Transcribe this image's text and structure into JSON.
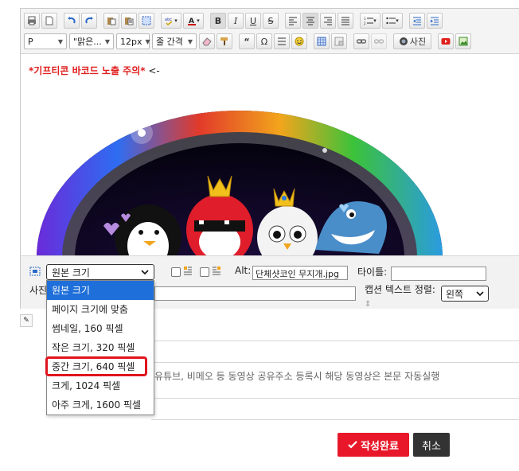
{
  "toolbar": {
    "paragraph_format": "P",
    "font_family": "\"맑은...",
    "font_size": "12px",
    "line_spacing": "줄 간격",
    "quote_glyph": "“",
    "omega_glyph": "Ω",
    "photo_label": "사진"
  },
  "content": {
    "notice_text": "*기프티콘 바코드 노출 주의*",
    "notice_arrow": " <-"
  },
  "image_props": {
    "alt_label": "Alt:",
    "alt_value": "단체샷코인 무지개.jpg",
    "title_label": "타이틀:",
    "title_value": "",
    "caption_label": "사진",
    "caption_align_label": "캡션 텍스트 정렬:",
    "caption_align_value": "왼쪽"
  },
  "size_dropdown": {
    "selected": "원본 크기",
    "options": [
      "원본 크기",
      "페이지 크기에 맞춤",
      "썸네일, 160 픽셀",
      "작은 크기, 320 픽셀",
      "중간 크기, 640 픽셀",
      "크게, 1024 픽셀",
      "아주 크게, 1600 픽셀"
    ],
    "highlighted_option": "중간 크기, 640 픽셀"
  },
  "video_hint": "유튜브, 비메오 등 동영상 공유주소 등록시 해당 동영상은 본문 자동실행",
  "actions": {
    "submit_label": "작성완료",
    "cancel_label": "취소"
  },
  "colors": {
    "accent_red": "#e8182a",
    "selected_blue": "#1e6fd9",
    "notice_red": "#e02020"
  }
}
